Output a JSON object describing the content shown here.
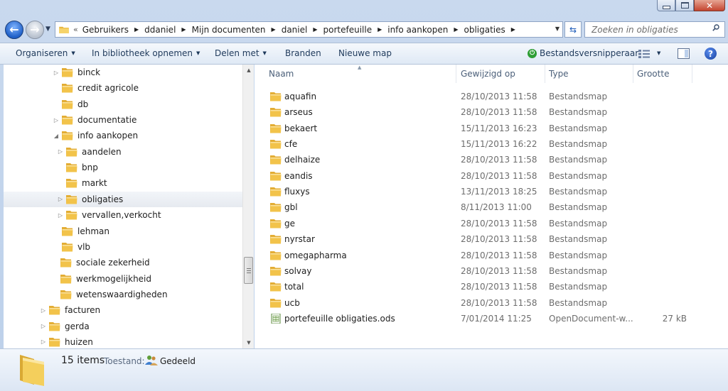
{
  "window": {
    "caption": {
      "minimize": "minimize-icon",
      "maximize": "maximize-icon",
      "close": "close-icon"
    }
  },
  "address": {
    "lead": "«",
    "crumbs": [
      "Gebruikers",
      "ddaniel",
      "Mijn documenten",
      "daniel",
      "portefeuille",
      "info aankopen",
      "obligaties"
    ],
    "separator": "▶"
  },
  "search": {
    "placeholder": "Zoeken in obligaties"
  },
  "commandbar": {
    "organize": "Organiseren",
    "library": "In bibliotheek opnemen",
    "share": "Delen met",
    "burn": "Branden",
    "new_folder": "Nieuwe map",
    "shredder": "Bestandsversnipperaar"
  },
  "tree": [
    {
      "label": "binck",
      "level": 2,
      "expander": "▷"
    },
    {
      "label": "credit agricole",
      "level": 2,
      "expander": ""
    },
    {
      "label": "db",
      "level": 2,
      "expander": ""
    },
    {
      "label": "documentatie",
      "level": 2,
      "expander": "▷"
    },
    {
      "label": "info aankopen",
      "level": 2,
      "expander": "◢"
    },
    {
      "label": "aandelen",
      "level": 3,
      "expander": "▷"
    },
    {
      "label": "bnp",
      "level": 3,
      "expander": ""
    },
    {
      "label": "markt",
      "level": 3,
      "expander": ""
    },
    {
      "label": "obligaties",
      "level": 3,
      "expander": "▷",
      "selected": true
    },
    {
      "label": "vervallen,verkocht",
      "level": 3,
      "expander": "▷"
    },
    {
      "label": "lehman",
      "level": 2,
      "expander": ""
    },
    {
      "label": "vlb",
      "level": 2,
      "expander": ""
    },
    {
      "label": "sociale zekerheid",
      "level": 1,
      "expander": ""
    },
    {
      "label": "werkmogelijkheid",
      "level": 1,
      "expander": ""
    },
    {
      "label": "wetenswaardigheden",
      "level": 1,
      "expander": ""
    },
    {
      "label": "facturen",
      "level": 0,
      "expander": "▷"
    },
    {
      "label": "gerda",
      "level": 0,
      "expander": "▷"
    },
    {
      "label": "huizen",
      "level": 0,
      "expander": "▷"
    }
  ],
  "columns": {
    "name": "Naam",
    "modified": "Gewijzigd op",
    "type": "Type",
    "size": "Grootte"
  },
  "files": [
    {
      "name": "aquafin",
      "date": "28/10/2013 11:58",
      "type": "Bestandsmap",
      "size": "",
      "kind": "folder"
    },
    {
      "name": "arseus",
      "date": "28/10/2013 11:58",
      "type": "Bestandsmap",
      "size": "",
      "kind": "folder"
    },
    {
      "name": "bekaert",
      "date": "15/11/2013 16:23",
      "type": "Bestandsmap",
      "size": "",
      "kind": "folder"
    },
    {
      "name": "cfe",
      "date": "15/11/2013 16:22",
      "type": "Bestandsmap",
      "size": "",
      "kind": "folder"
    },
    {
      "name": "delhaize",
      "date": "28/10/2013 11:58",
      "type": "Bestandsmap",
      "size": "",
      "kind": "folder"
    },
    {
      "name": "eandis",
      "date": "28/10/2013 11:58",
      "type": "Bestandsmap",
      "size": "",
      "kind": "folder"
    },
    {
      "name": "fluxys",
      "date": "13/11/2013 18:25",
      "type": "Bestandsmap",
      "size": "",
      "kind": "folder"
    },
    {
      "name": "gbl",
      "date": "8/11/2013 11:00",
      "type": "Bestandsmap",
      "size": "",
      "kind": "folder"
    },
    {
      "name": "ge",
      "date": "28/10/2013 11:58",
      "type": "Bestandsmap",
      "size": "",
      "kind": "folder"
    },
    {
      "name": "nyrstar",
      "date": "28/10/2013 11:58",
      "type": "Bestandsmap",
      "size": "",
      "kind": "folder"
    },
    {
      "name": "omegapharma",
      "date": "28/10/2013 11:58",
      "type": "Bestandsmap",
      "size": "",
      "kind": "folder"
    },
    {
      "name": "solvay",
      "date": "28/10/2013 11:58",
      "type": "Bestandsmap",
      "size": "",
      "kind": "folder"
    },
    {
      "name": "total",
      "date": "28/10/2013 11:58",
      "type": "Bestandsmap",
      "size": "",
      "kind": "folder"
    },
    {
      "name": "ucb",
      "date": "28/10/2013 11:58",
      "type": "Bestandsmap",
      "size": "",
      "kind": "folder"
    },
    {
      "name": "portefeuille obligaties.ods",
      "date": "7/01/2014 11:25",
      "type": "OpenDocument-w...",
      "size": "27 kB",
      "kind": "spreadsheet"
    }
  ],
  "details": {
    "count": "15 items",
    "state_label": "Toestand:",
    "state_value": "Gedeeld"
  },
  "colors": {
    "folder": "#f2c34a",
    "accent": "#1e395b",
    "selection": "#e6eaf0"
  }
}
